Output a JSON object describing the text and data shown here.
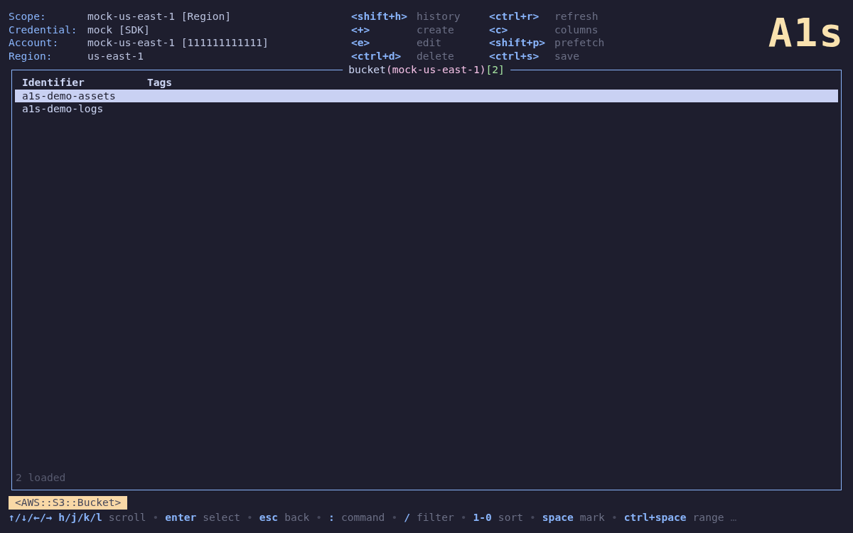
{
  "context": [
    {
      "label": "Scope:",
      "value": "mock-us-east-1 [Region]"
    },
    {
      "label": "Credential:",
      "value": "mock [SDK]"
    },
    {
      "label": "Account:",
      "value": "mock-us-east-1 [111111111111]"
    },
    {
      "label": "Region:",
      "value": "us-east-1"
    }
  ],
  "shortcuts": [
    [
      {
        "key": "<shift+h>",
        "action": "history"
      },
      {
        "key": "<+>",
        "action": "create"
      },
      {
        "key": "<e>",
        "action": "edit"
      },
      {
        "key": "<ctrl+d>",
        "action": "delete"
      }
    ],
    [
      {
        "key": "<ctrl+r>",
        "action": "refresh"
      },
      {
        "key": "<c>",
        "action": "columns"
      },
      {
        "key": "<shift+p>",
        "action": "prefetch"
      },
      {
        "key": "<ctrl+s>",
        "action": "save"
      }
    ]
  ],
  "logo": "A1s",
  "panel": {
    "title": {
      "resource": "bucket",
      "scope": "(mock-us-east-1)",
      "count": "[2]"
    },
    "columns": [
      "Identifier",
      "Tags"
    ],
    "rows": [
      {
        "identifier": "a1s-demo-assets",
        "selected": true
      },
      {
        "identifier": "a1s-demo-logs",
        "selected": false
      }
    ],
    "status": "2 loaded"
  },
  "resource_type": "<AWS::S3::Bucket>",
  "hints": [
    {
      "key": "↑/↓/←/→ h/j/k/l",
      "action": "scroll"
    },
    {
      "key": "enter",
      "action": "select"
    },
    {
      "key": "esc",
      "action": "back"
    },
    {
      "key": ":",
      "action": "command"
    },
    {
      "key": "/",
      "action": "filter"
    },
    {
      "key": "1-0",
      "action": "sort"
    },
    {
      "key": "space",
      "action": "mark"
    },
    {
      "key": "ctrl+space",
      "action": "range"
    }
  ],
  "hint_separator": "•",
  "hint_more": "…"
}
